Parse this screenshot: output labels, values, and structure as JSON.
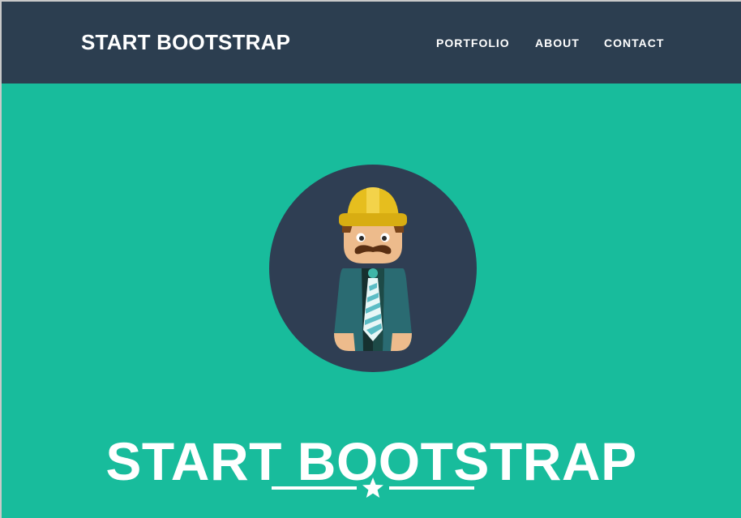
{
  "navbar": {
    "brand": "START BOOTSTRAP",
    "links": [
      {
        "label": "PORTFOLIO"
      },
      {
        "label": "ABOUT"
      },
      {
        "label": "CONTACT"
      }
    ],
    "background": "#2c3e50"
  },
  "hero": {
    "title": "START BOOTSTRAP",
    "avatar_icon": "construction-worker-avatar",
    "divider_icon": "star-icon",
    "background": "#18bc9c"
  }
}
